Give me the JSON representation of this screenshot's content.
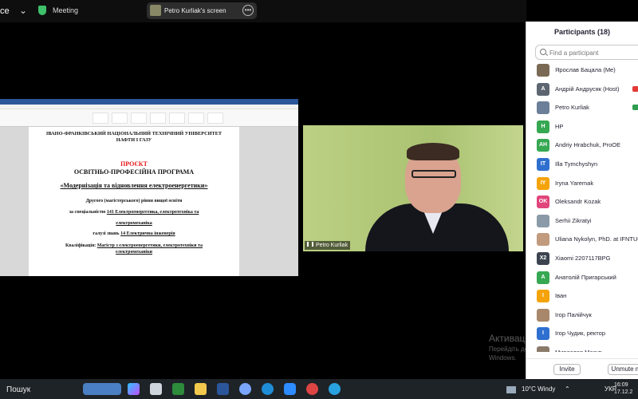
{
  "topbar": {
    "brand_fragment": "ce",
    "meeting_label": "Meeting",
    "share_label": "Petro Kurliak's screen",
    "more_glyph": "•••"
  },
  "document": {
    "university_line1": "ІВАНО-ФРАНКІВСЬКИЙ НАЦІОНАЛЬНИЙ ТЕХНІЧНИЙ УНІВЕРСИТЕТ",
    "university_line2": "НАФТИ І ГАЗУ",
    "draft": "ПРОЄКТ",
    "program_type": "ОСВІТНЬО-ПРОФЕСІЙНА ПРОГРАМА",
    "program_name": "«Модернізація та відновлення електроенергетики»",
    "level": "Другого (магістерського) рівня вищої освіти",
    "specialty_prefix": "за спеціальністю",
    "specialty": "141 Електроенергетика, електротехніка та",
    "specialty_cont": "електромеханіка",
    "field_prefix": "галузі знань",
    "field": "14 Електрична інженерія",
    "qualification_prefix": "Кваліфікація:",
    "qualification": "Магістр з електроенергетики, електротехніки та",
    "qualification_cont": "електромеханіки"
  },
  "video": {
    "name": "Petro Kurliak"
  },
  "participants": {
    "title": "Participants (18)",
    "search_placeholder": "Find a participant",
    "items": [
      {
        "name": "Ярослав Бацала (Me)",
        "initials": "",
        "color": "#7a6a55",
        "status": ""
      },
      {
        "name": "Андрій Андрусяк (Host)",
        "initials": "A",
        "color": "#5d6670",
        "status": "#e53935"
      },
      {
        "name": "Petro Kurliak",
        "initials": "",
        "color": "#6b7f99",
        "status": "#2e9e4f"
      },
      {
        "name": "HP",
        "initials": "H",
        "color": "#36a852",
        "status": ""
      },
      {
        "name": "Andriy Hrabchuk, ProOE",
        "initials": "AH",
        "color": "#36a852",
        "status": ""
      },
      {
        "name": "Illa Tymchyshyn",
        "initials": "IT",
        "color": "#2e6fcf",
        "status": ""
      },
      {
        "name": "Iryna Yaremak",
        "initials": "IY",
        "color": "#f5a30a",
        "status": ""
      },
      {
        "name": "Oleksandr Kozak",
        "initials": "OK",
        "color": "#e0457b",
        "status": ""
      },
      {
        "name": "Serhii Zikratyi",
        "initials": "",
        "color": "#8a9aa8",
        "status": ""
      },
      {
        "name": "Uliana Nykolyn, PhD. at IFNTUOG",
        "initials": "",
        "color": "#c29a7d",
        "status": ""
      },
      {
        "name": "Xiaomi 2207117BPG",
        "initials": "X2",
        "color": "#3d4450",
        "status": ""
      },
      {
        "name": "Анатолій Пригарський",
        "initials": "A",
        "color": "#36a852",
        "status": ""
      },
      {
        "name": "Іван",
        "initials": "I",
        "color": "#f5a30a",
        "status": ""
      },
      {
        "name": "Ігор Палійчук",
        "initials": "",
        "color": "#a8876a",
        "status": ""
      },
      {
        "name": "Ігор Чудик, ректор",
        "initials": "I",
        "color": "#2e6fcf",
        "status": ""
      },
      {
        "name": "Мирослав Мазур",
        "initials": "",
        "color": "#8a7a6a",
        "status": ""
      }
    ],
    "invite_label": "Invite",
    "unmute_label": "Unmute m"
  },
  "watermark": {
    "title": "Активація Windows",
    "line1": "Перейдіть до розділу \"Настройки\", щоб активува",
    "line2": "Windows."
  },
  "taskbar": {
    "search_label": "Пошук",
    "weather": "10°C  Windy",
    "language": "УКР",
    "time": "16:09",
    "date": "17.12.2"
  }
}
